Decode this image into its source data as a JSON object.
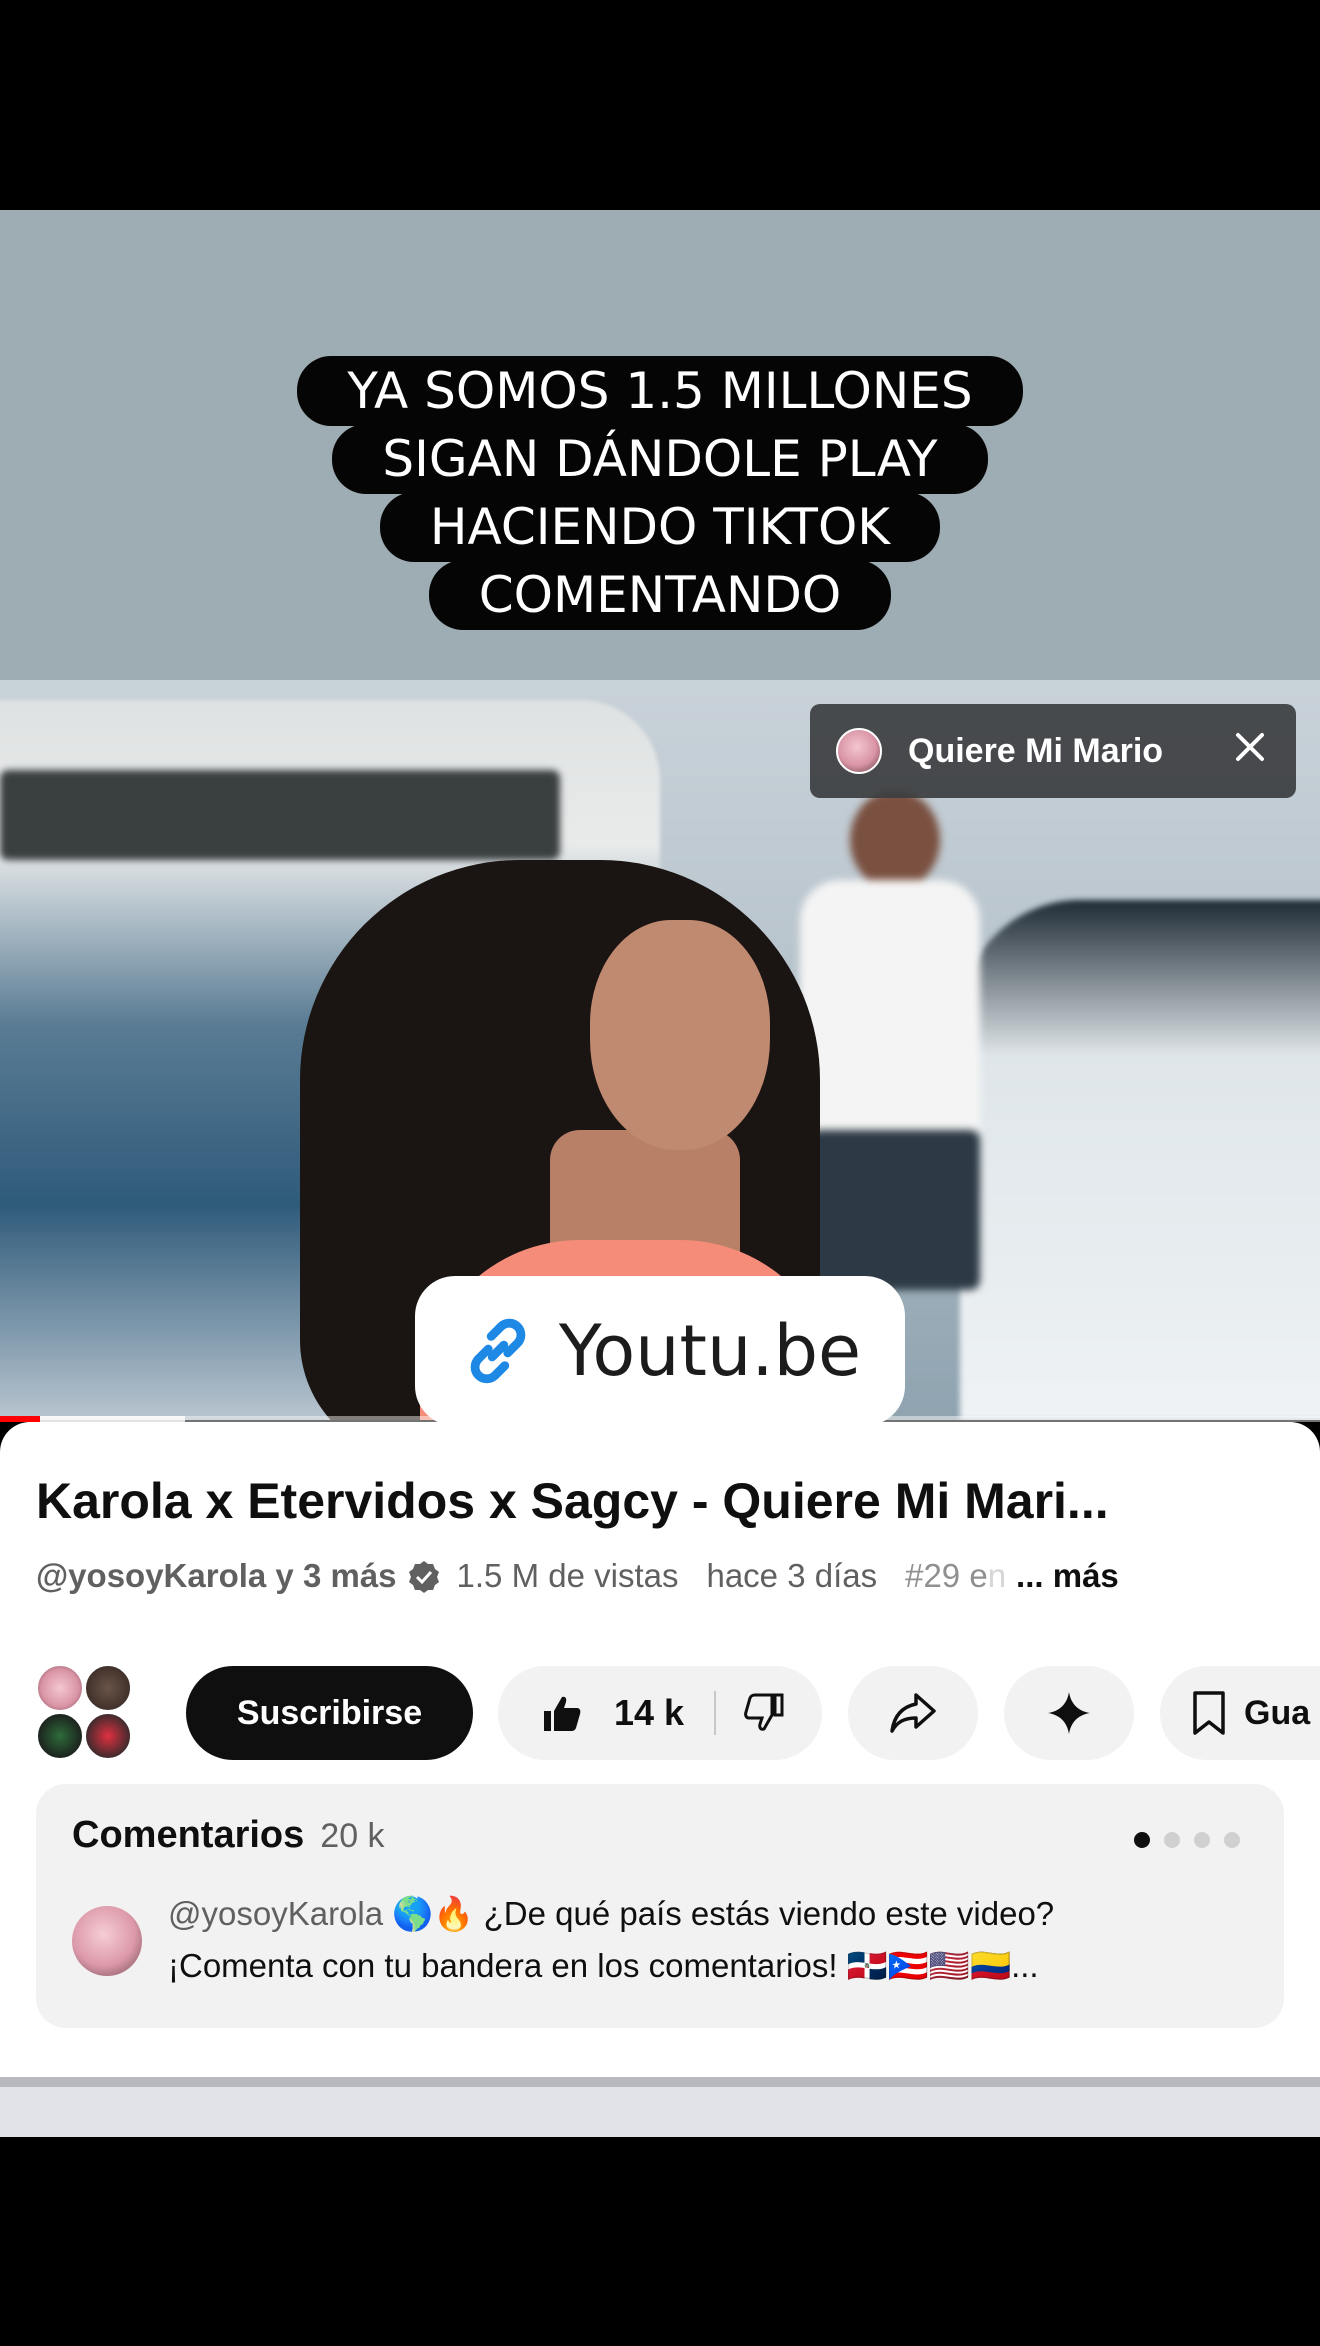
{
  "story": {
    "caption_lines": [
      "YA SOMOS 1.5 MILLONES",
      "SIGAN DÁNDOLE PLAY",
      "HACIENDO TIKTOK",
      "COMENTANDO"
    ],
    "music_chip": {
      "label": "Quiere Mi Mario",
      "icon": "music-avatar-icon",
      "close_icon": "close-icon"
    },
    "link_sticker": {
      "text": "Youtu.be",
      "icon": "link-icon"
    }
  },
  "video": {
    "progress": {
      "played_fraction": 0.03,
      "buffered_fraction": 0.14,
      "color": "#ff0000"
    },
    "title": "Karola x Etervidos x Sagcy - Quiere Mi Mari...",
    "channel": "@yosoyKarola y 3 más",
    "views": "1.5 M de vistas",
    "age": "hace 3 días",
    "tag_visible": "#29 e",
    "tag_faded": "n",
    "more": "... más",
    "subscribe_label": "Suscribirse",
    "likes": "14 k",
    "save_label": "Gua"
  },
  "comments": {
    "title": "Comentarios",
    "count": "20 k",
    "page_dots": 4,
    "active_dot": 0,
    "top_comment": {
      "user": "@yosoyKarola",
      "emoji_prefix": "🌎🔥",
      "line1": "¿De qué país estás viendo este video?",
      "line2": "¡Comenta con tu bandera en los comentarios!",
      "flags": "🇩🇴🇵🇷🇺🇸🇨🇴",
      "ellipsis": "..."
    }
  }
}
